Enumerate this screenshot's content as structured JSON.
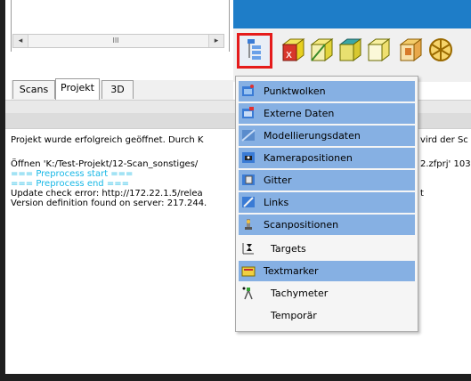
{
  "scrollbar": {
    "left_arrow": "◂",
    "right_arrow": "▸",
    "thumb_grip": "III"
  },
  "tabs": [
    {
      "label": "Scans"
    },
    {
      "label": "Projekt"
    },
    {
      "label": "3D"
    }
  ],
  "log": {
    "lines": [
      "Projekt wurde erfolgreich geöffnet. Durch K",
      "Öffnen 'K:/Test-Projekt/12-Scan_sonstiges/",
      "=== Preprocess start ===",
      "=== Preprocess end ===",
      "Update check error: http://172.22.1.5/relea",
      "Version definition found on server: 217.244."
    ],
    "right_fragments": [
      "vird der Sc",
      "2.zfprj' 103",
      "t"
    ]
  },
  "menu": {
    "items": [
      {
        "label": "Punktwolken",
        "highlighted": true,
        "icon": "point-cloud-icon"
      },
      {
        "label": "Externe Daten",
        "highlighted": true,
        "icon": "external-data-icon"
      },
      {
        "label": "Modellierungsdaten",
        "highlighted": true,
        "icon": "modeling-data-icon"
      },
      {
        "label": "Kamerapositionen",
        "highlighted": true,
        "icon": "camera-positions-icon"
      },
      {
        "label": "Gitter",
        "highlighted": true,
        "icon": "grid-icon"
      },
      {
        "label": "Links",
        "highlighted": true,
        "icon": "links-icon"
      },
      {
        "label": "Scanpositionen",
        "highlighted": true,
        "icon": "scan-positions-icon"
      },
      {
        "label": "Targets",
        "highlighted": false,
        "icon": "targets-icon"
      },
      {
        "label": "Textmarker",
        "highlighted": true,
        "icon": "text-marker-icon"
      },
      {
        "label": "Tachymeter",
        "highlighted": false,
        "icon": "tachymeter-icon"
      },
      {
        "label": "Temporär",
        "highlighted": false,
        "icon": ""
      }
    ]
  },
  "colors": {
    "title_blue": "#1e7dc8",
    "menu_highlight": "#86b0e3",
    "selection_frame": "#e51b1b",
    "log_info": "#19b8e6"
  }
}
